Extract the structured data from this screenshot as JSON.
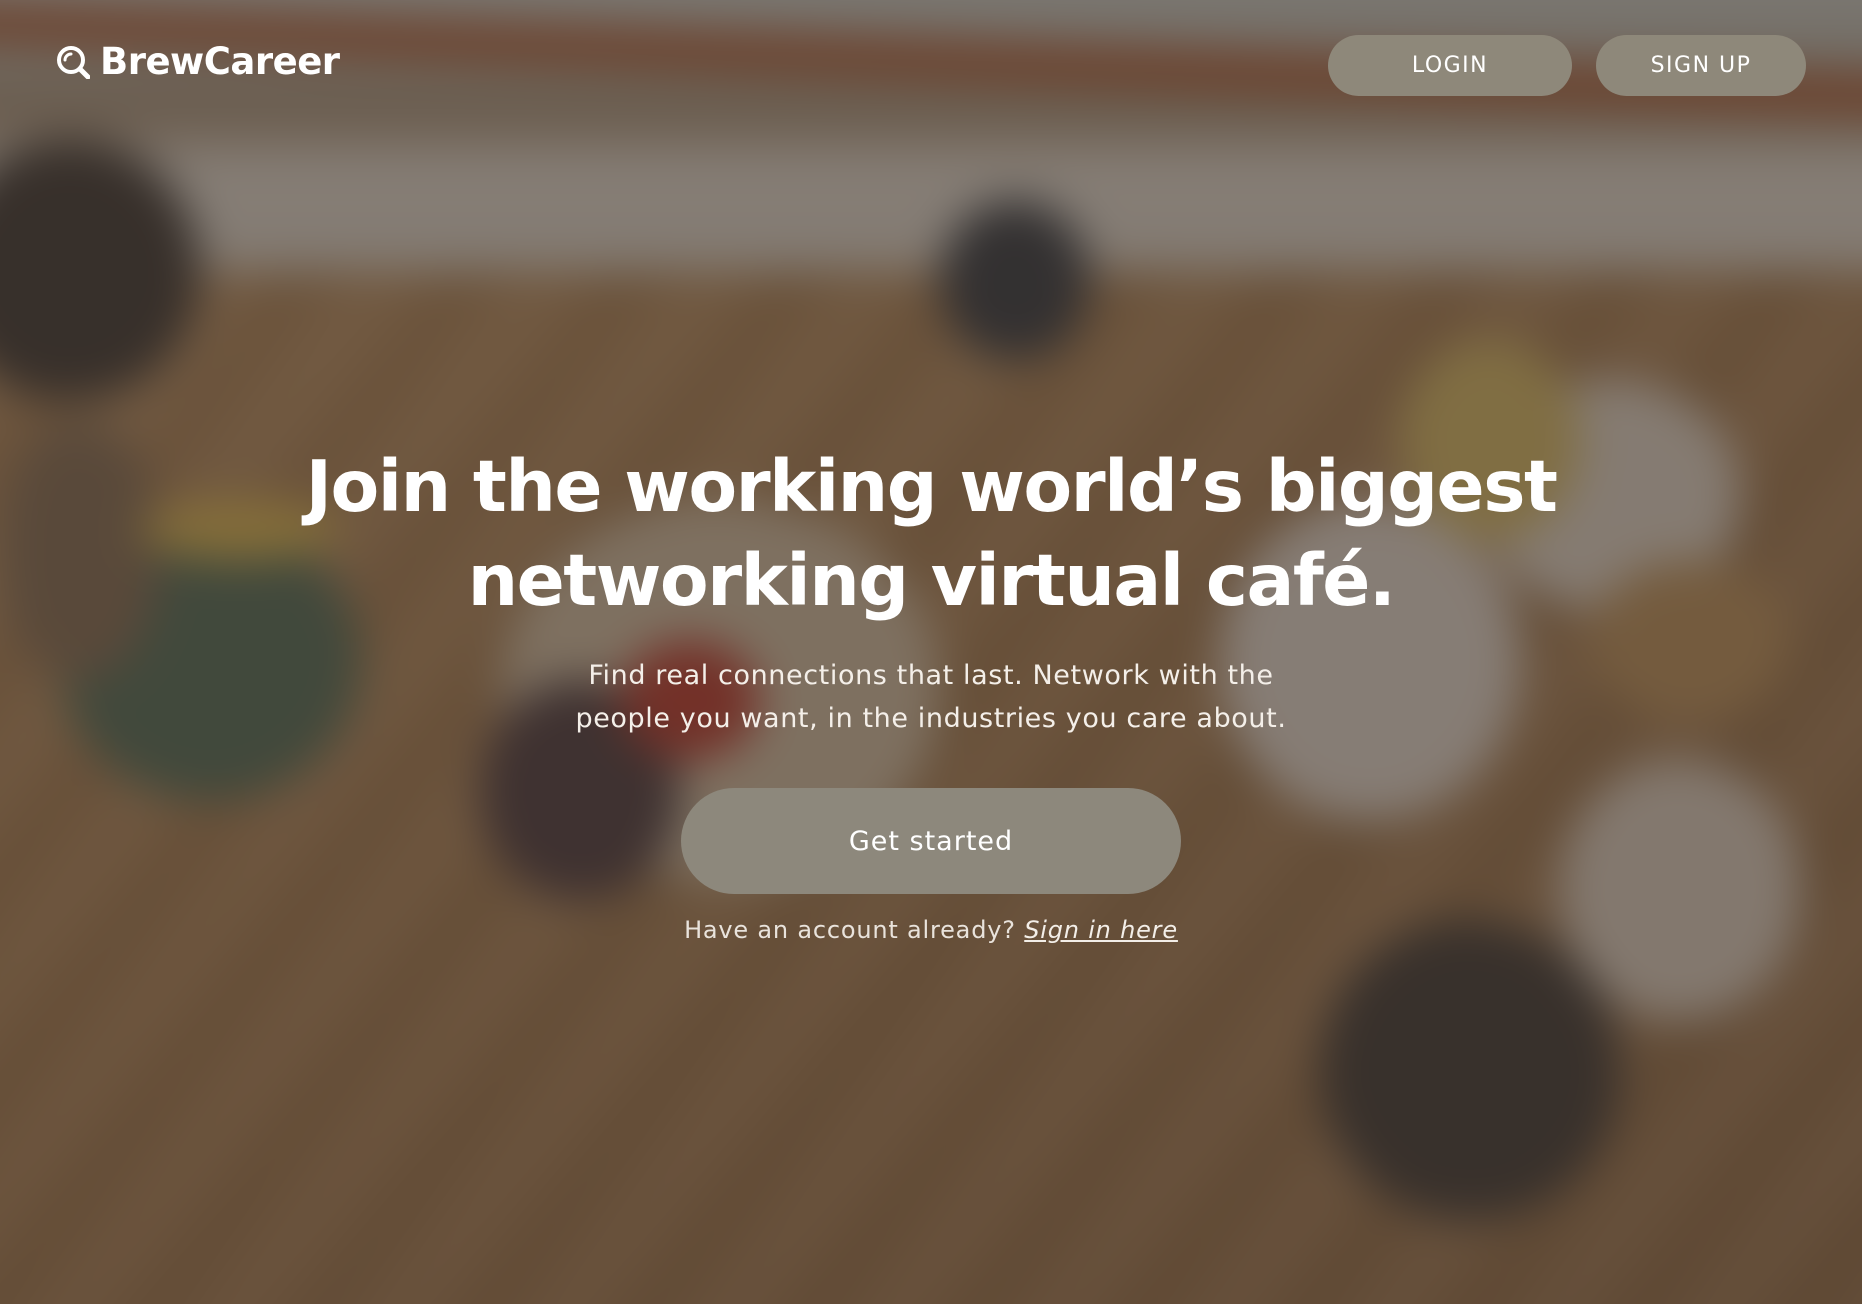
{
  "brand": {
    "name": "BrewCareer",
    "icon": "magnifier-logo-icon"
  },
  "nav": {
    "login_label": "LOGIN",
    "signup_label": "SIGN UP"
  },
  "hero": {
    "headline_line1": "Join the working world’s biggest",
    "headline_line2": "networking virtual café.",
    "subtitle_line1": "Find real connections that last. Network with the",
    "subtitle_line2": "people you want, in the industries you care about.",
    "cta_label": "Get started",
    "account_prompt": "Have an account already?",
    "sign_in_link": "Sign in here"
  },
  "colors": {
    "pill_background": "#8e887a",
    "cta_background": "#8d887c",
    "text": "#ffffff"
  }
}
